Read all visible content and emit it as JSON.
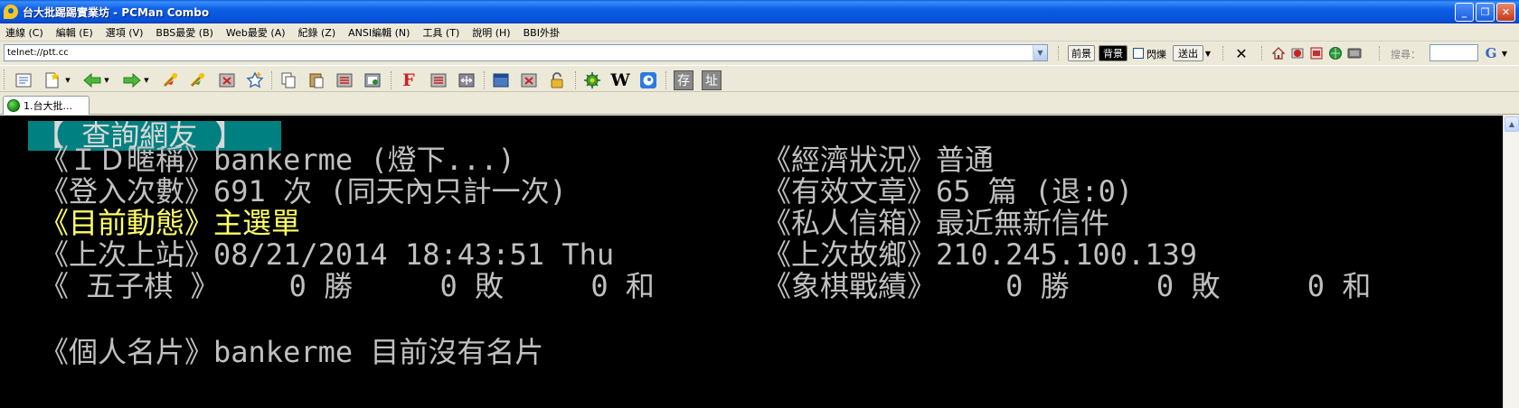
{
  "window": {
    "title": "台大批踢踢實業坊 - PCMan Combo",
    "controls": [
      "_",
      "❐",
      "✕"
    ]
  },
  "menu": [
    "連線 (C)",
    "編輯 (E)",
    "選項 (V)",
    "BBS最愛 (B)",
    "Web最愛 (A)",
    "紀錄 (Z)",
    "ANSI編輯 (N)",
    "工具 (T)",
    "說明 (H)",
    "BBI外掛"
  ],
  "address": {
    "value": "telnet://ptt.cc"
  },
  "address_toolbar": {
    "foreground_label": "前景",
    "background_label": "背景",
    "blink_label": "閃爍",
    "send_label": "送出",
    "search_label": "搜尋："
  },
  "toolbar_icons": [
    "address-book-icon",
    "new-connection-icon",
    "back-icon",
    "forward-icon",
    "reconnect-icon",
    "reconnect-all-icon",
    "close-tab-icon",
    "add-favorite-icon",
    "copy-icon",
    "paste-icon",
    "copy-article-icon",
    "screenshot-icon",
    "font-icon",
    "find-icon",
    "fit-window-icon",
    "window-icon",
    "delete-icon",
    "lock-icon",
    "settings-gear-icon",
    "wikipedia-icon",
    "pcman-icon",
    "save-icon",
    "address-icon"
  ],
  "toolbar_labels": {
    "font": "F",
    "wiki": "W",
    "save": "存",
    "address": "址"
  },
  "tabs": [
    {
      "label": "1.台大批..."
    }
  ],
  "terminal": {
    "header": "【 查詢網友 】",
    "rows": [
      {
        "left": "《ＩＤ暱稱》bankerme (燈下...)",
        "right": "《經濟狀況》普通"
      },
      {
        "left": "《登入次數》691 次 (同天內只計一次)",
        "right": "《有效文章》65 篇 (退:0)"
      },
      {
        "left": "《目前動態》主選單",
        "right": "《私人信箱》最近無新信件",
        "left_highlight": true
      },
      {
        "left": "《上次上站》08/21/2014 18:43:51 Thu",
        "right": "《上次故鄉》210.245.100.139"
      },
      {
        "left": "《 五子棋 》    0 勝     0 敗     0 和",
        "right": "《象棋戰績》    0 勝     0 敗     0 和"
      }
    ],
    "card": "《個人名片》bankerme 目前沒有名片"
  },
  "colors": {
    "terminal_bg": "#000000",
    "terminal_text": "#c0c0c0",
    "highlight": "#ffff66",
    "header_bg": "#008080"
  }
}
